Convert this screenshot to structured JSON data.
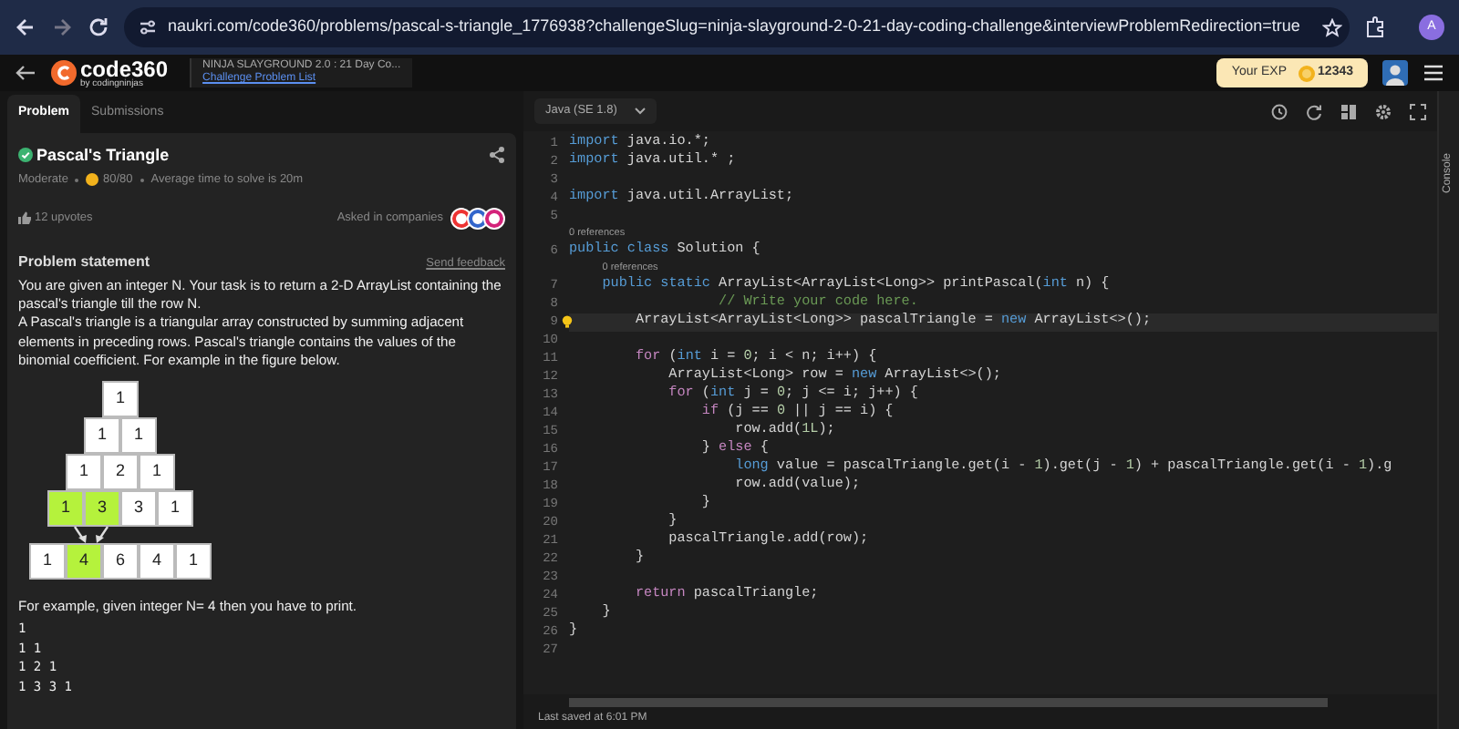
{
  "browser": {
    "url": "naukri.com/code360/problems/pascal-s-triangle_1776938?challengeSlug=ninja-slayground-2-0-21-day-coding-challenge&interviewProblemRedirection=true",
    "profile": "A"
  },
  "header": {
    "logo": "code360",
    "logo_sub": "by codingninjas",
    "challenge": "NINJA SLAYGROUND 2.0 : 21 Day Co...",
    "challenge_link": "Challenge Problem List",
    "exp_label": "Your EXP",
    "exp_value": "12343"
  },
  "tabs": [
    {
      "label": "Problem",
      "selected": true
    },
    {
      "label": "Submissions",
      "selected": false
    }
  ],
  "problem": {
    "title": "Pascal's Triangle",
    "solved": true,
    "difficulty": "Moderate",
    "score": "80/80",
    "avg_time": "Average time to solve is 20m",
    "upvotes": "12 upvotes",
    "companies_label": "Asked in companies",
    "statement_heading": "Problem statement",
    "feedback": "Send feedback",
    "paragraphs": [
      "You are given an integer N. Your task is to return a 2-D ArrayList containing the pascal's triangle till the row N.",
      "A Pascal's triangle is a triangular array constructed by summing adjacent elements in preceding rows. Pascal's triangle contains the values of the binomial coefficient. For example in the figure below."
    ],
    "triangle": [
      [
        {
          "text": "1",
          "highlighted": false
        }
      ],
      [
        {
          "text": "1",
          "highlighted": false
        },
        {
          "text": "1",
          "highlighted": false
        }
      ],
      [
        {
          "text": "1",
          "highlighted": false
        },
        {
          "text": "2",
          "highlighted": false
        },
        {
          "text": "1",
          "highlighted": false
        }
      ],
      [
        {
          "text": "1",
          "highlighted": true
        },
        {
          "text": "3",
          "highlighted": true
        },
        {
          "text": "3",
          "highlighted": false
        },
        {
          "text": "1",
          "highlighted": false
        }
      ],
      [
        {
          "text": "1",
          "highlighted": false
        },
        {
          "text": "4",
          "highlighted": true
        },
        {
          "text": "6",
          "highlighted": false
        },
        {
          "text": "4",
          "highlighted": false
        },
        {
          "text": "1",
          "highlighted": false
        }
      ]
    ],
    "example": "For example, given integer N= 4 then you have to print.",
    "output": [
      "1",
      "1 1",
      "1 2 1",
      "1 3 3 1"
    ]
  },
  "editor": {
    "language": "Java (SE 1.8)",
    "status": "Last saved at 6:01 PM",
    "console": "Console",
    "lines": [
      {
        "n": "1",
        "current": false,
        "tokens": [
          {
            "kind": "kw",
            "text": "import"
          },
          {
            "kind": "plain",
            "text": " java.io.*;"
          }
        ]
      },
      {
        "n": "2",
        "current": false,
        "tokens": [
          {
            "kind": "kw",
            "text": "import"
          },
          {
            "kind": "plain",
            "text": " java.util.* ;"
          }
        ]
      },
      {
        "n": "3",
        "current": false
      },
      {
        "n": "4",
        "current": false,
        "tokens": [
          {
            "kind": "kw",
            "text": "import"
          },
          {
            "kind": "plain",
            "text": " java.util.ArrayList;"
          }
        ]
      },
      {
        "n": "5",
        "current": false
      },
      {
        "n": "6",
        "current": false,
        "codelens": "0 references",
        "tokens": [
          {
            "kind": "kw",
            "text": "public"
          },
          {
            "kind": "kw",
            "text": " class"
          },
          {
            "kind": "plain",
            "text": " Solution {"
          }
        ]
      },
      {
        "n": "7",
        "current": false,
        "codelens": "0 references",
        "tokens": [
          {
            "kind": "kw",
            "text": "    public"
          },
          {
            "kind": "kw",
            "text": " static"
          },
          {
            "kind": "plain",
            "text": " ArrayList<ArrayList<Long>> printPascal("
          },
          {
            "kind": "kw",
            "text": "int"
          },
          {
            "kind": "plain",
            "text": " n) {"
          }
        ]
      },
      {
        "n": "8",
        "current": false,
        "tokens": [
          {
            "kind": "comment",
            "text": "                  // Write your code here."
          }
        ]
      },
      {
        "n": "9",
        "current": true,
        "tokens": [
          {
            "kind": "plain",
            "text": "        ArrayList<ArrayList<Long>> pascalTriangle = "
          },
          {
            "kind": "kw",
            "text": "new"
          },
          {
            "kind": "plain",
            "text": " ArrayList<>();"
          }
        ]
      },
      {
        "n": "10",
        "current": false
      },
      {
        "n": "11",
        "current": false,
        "tokens": [
          {
            "kind": "ctrl",
            "text": "        for"
          },
          {
            "kind": "plain",
            "text": " ("
          },
          {
            "kind": "kw",
            "text": "int"
          },
          {
            "kind": "plain",
            "text": " i = "
          },
          {
            "kind": "num",
            "text": "0"
          },
          {
            "kind": "plain",
            "text": "; i < n; i++) {"
          }
        ]
      },
      {
        "n": "12",
        "current": false,
        "tokens": [
          {
            "kind": "plain",
            "text": "            ArrayList<Long> row = "
          },
          {
            "kind": "kw",
            "text": "new"
          },
          {
            "kind": "plain",
            "text": " ArrayList<>();"
          }
        ]
      },
      {
        "n": "13",
        "current": false,
        "tokens": [
          {
            "kind": "ctrl",
            "text": "            for"
          },
          {
            "kind": "plain",
            "text": " ("
          },
          {
            "kind": "kw",
            "text": "int"
          },
          {
            "kind": "plain",
            "text": " j = "
          },
          {
            "kind": "num",
            "text": "0"
          },
          {
            "kind": "plain",
            "text": "; j <= i; j++) {"
          }
        ]
      },
      {
        "n": "14",
        "current": false,
        "tokens": [
          {
            "kind": "ctrl",
            "text": "                if"
          },
          {
            "kind": "plain",
            "text": " (j == "
          },
          {
            "kind": "num",
            "text": "0"
          },
          {
            "kind": "plain",
            "text": " || j == i) {"
          }
        ]
      },
      {
        "n": "15",
        "current": false,
        "tokens": [
          {
            "kind": "plain",
            "text": "                    row.add("
          },
          {
            "kind": "num",
            "text": "1L"
          },
          {
            "kind": "plain",
            "text": ");"
          }
        ]
      },
      {
        "n": "16",
        "current": false,
        "tokens": [
          {
            "kind": "plain",
            "text": "                } "
          },
          {
            "kind": "ctrl",
            "text": "else"
          },
          {
            "kind": "plain",
            "text": " {"
          }
        ]
      },
      {
        "n": "17",
        "current": false,
        "tokens": [
          {
            "kind": "kw",
            "text": "                    long"
          },
          {
            "kind": "plain",
            "text": " value = pascalTriangle.get(i - "
          },
          {
            "kind": "num",
            "text": "1"
          },
          {
            "kind": "plain",
            "text": ").get(j - "
          },
          {
            "kind": "num",
            "text": "1"
          },
          {
            "kind": "plain",
            "text": ") + pascalTriangle.get(i - "
          },
          {
            "kind": "num",
            "text": "1"
          },
          {
            "kind": "plain",
            "text": ").g"
          }
        ]
      },
      {
        "n": "18",
        "current": false,
        "tokens": [
          {
            "kind": "plain",
            "text": "                    row.add(value);"
          }
        ]
      },
      {
        "n": "19",
        "current": false,
        "tokens": [
          {
            "kind": "plain",
            "text": "                }"
          }
        ]
      },
      {
        "n": "20",
        "current": false,
        "tokens": [
          {
            "kind": "plain",
            "text": "            }"
          }
        ]
      },
      {
        "n": "21",
        "current": false,
        "tokens": [
          {
            "kind": "plain",
            "text": "            pascalTriangle.add(row);"
          }
        ]
      },
      {
        "n": "22",
        "current": false,
        "tokens": [
          {
            "kind": "plain",
            "text": "        }"
          }
        ]
      },
      {
        "n": "23",
        "current": false
      },
      {
        "n": "24",
        "current": false,
        "tokens": [
          {
            "kind": "ctrl",
            "text": "        return"
          },
          {
            "kind": "plain",
            "text": " pascalTriangle;"
          }
        ]
      },
      {
        "n": "25",
        "current": false,
        "tokens": [
          {
            "kind": "plain",
            "text": "    }"
          }
        ]
      },
      {
        "n": "26",
        "current": false,
        "tokens": [
          {
            "kind": "plain",
            "text": "}"
          }
        ]
      },
      {
        "n": "27",
        "current": false
      }
    ]
  }
}
